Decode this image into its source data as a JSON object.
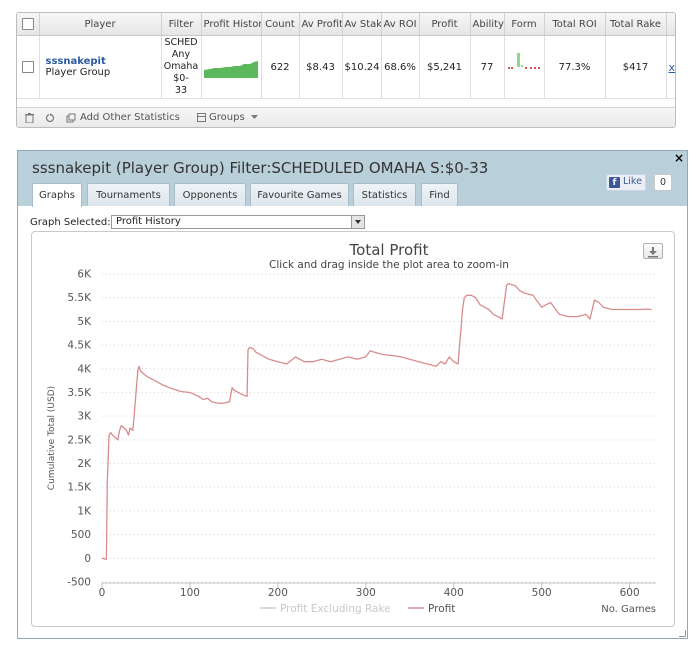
{
  "stats_table": {
    "headers": [
      "Player",
      "Filter",
      "Profit History",
      "Count",
      "Av Profit",
      "Av Stake",
      "Av ROI",
      "Profit",
      "Ability",
      "Form",
      "Total ROI",
      "Total Rake"
    ],
    "row": {
      "player_name": "sssnakepit",
      "player_sub": "Player Group",
      "filter_lines": [
        "SCHED",
        "Any",
        "Omaha",
        "$0-",
        "33"
      ],
      "count": "622",
      "av_profit": "$8.43",
      "av_stake": "$10.24",
      "av_roi": "68.6%",
      "profit": "$5,241",
      "ability": "77",
      "total_roi": "77.3%",
      "total_rake": "$417",
      "remove": "x"
    },
    "footer": {
      "add_stats": "Add Other Statistics",
      "groups": "Groups"
    },
    "colors": {
      "spark_fill": "#5cb85c",
      "form_up": "#90d890",
      "form_down": "#d9534f"
    }
  },
  "panel": {
    "title": "sssnakepit (Player Group) Filter:SCHEDULED OMAHA S:$0-33",
    "close": "×",
    "fb_like": "Like",
    "fb_count": "0",
    "tabs": [
      "Graphs",
      "Tournaments",
      "Opponents",
      "Favourite Games",
      "Statistics",
      "Find"
    ],
    "active_tab": "Graphs",
    "graph_selected_label": "Graph Selected:",
    "graph_selected_value": "Profit History",
    "header_color": "#b9d0db"
  },
  "chart_data": {
    "type": "line",
    "title": "Total Profit",
    "subtitle": "Click and drag inside the plot area to zoom-in",
    "xlabel": "No. Games",
    "ylabel": "Cumulative Total (USD)",
    "xlim": [
      0,
      630
    ],
    "ylim": [
      -500,
      6000
    ],
    "x_ticks": [
      0,
      100,
      200,
      300,
      400,
      500,
      600
    ],
    "y_ticks": [
      -500,
      0,
      500,
      1000,
      1500,
      2000,
      2500,
      3000,
      3500,
      4000,
      4500,
      5000,
      5500,
      6000
    ],
    "y_tick_labels": [
      "-500",
      "0",
      "500",
      "1K",
      "1.5K",
      "2K",
      "2.5K",
      "3K",
      "3.5K",
      "4K",
      "4.5K",
      "5K",
      "5.5K",
      "6K"
    ],
    "grid": "horizontal dotted",
    "legend_position": "bottom-center",
    "series": [
      {
        "name": "Profit Excluding Rake",
        "color": "#cccccc",
        "visible": false,
        "x": [],
        "y": []
      },
      {
        "name": "Profit",
        "color": "#d98c8c",
        "visible": true,
        "x": [
          0,
          5,
          6,
          7,
          8,
          10,
          12,
          15,
          18,
          20,
          22,
          25,
          28,
          30,
          32,
          35,
          37,
          40,
          41,
          42,
          44,
          50,
          60,
          70,
          80,
          90,
          100,
          110,
          115,
          120,
          125,
          130,
          135,
          140,
          145,
          148,
          150,
          155,
          160,
          165,
          166,
          168,
          172,
          175,
          180,
          190,
          200,
          210,
          220,
          230,
          240,
          250,
          260,
          270,
          280,
          290,
          300,
          305,
          310,
          320,
          330,
          340,
          350,
          360,
          370,
          380,
          385,
          390,
          395,
          400,
          405,
          410,
          412,
          415,
          418,
          420,
          425,
          430,
          435,
          440,
          445,
          450,
          455,
          460,
          462,
          465,
          470,
          475,
          480,
          490,
          500,
          510,
          520,
          530,
          540,
          545,
          550,
          555,
          560,
          565,
          570,
          580,
          590,
          600,
          610,
          620,
          625
        ],
        "y": [
          0,
          -20,
          1600,
          2100,
          2600,
          2650,
          2600,
          2550,
          2500,
          2700,
          2800,
          2750,
          2700,
          2600,
          2750,
          2700,
          3100,
          3800,
          4000,
          4050,
          3950,
          3850,
          3750,
          3650,
          3580,
          3520,
          3500,
          3420,
          3350,
          3380,
          3300,
          3280,
          3270,
          3280,
          3300,
          3600,
          3550,
          3500,
          3450,
          3420,
          4400,
          4450,
          4420,
          4350,
          4300,
          4200,
          4150,
          4100,
          4250,
          4150,
          4150,
          4200,
          4150,
          4200,
          4250,
          4200,
          4250,
          4380,
          4350,
          4300,
          4280,
          4250,
          4200,
          4150,
          4100,
          4050,
          4150,
          4100,
          4250,
          4150,
          4100,
          5250,
          5500,
          5550,
          5550,
          5550,
          5500,
          5350,
          5300,
          5250,
          5150,
          5100,
          5050,
          5750,
          5800,
          5780,
          5750,
          5650,
          5600,
          5550,
          5300,
          5400,
          5150,
          5100,
          5100,
          5120,
          5150,
          5050,
          5450,
          5400,
          5300,
          5250,
          5250,
          5250,
          5250,
          5260,
          5250
        ]
      }
    ]
  }
}
